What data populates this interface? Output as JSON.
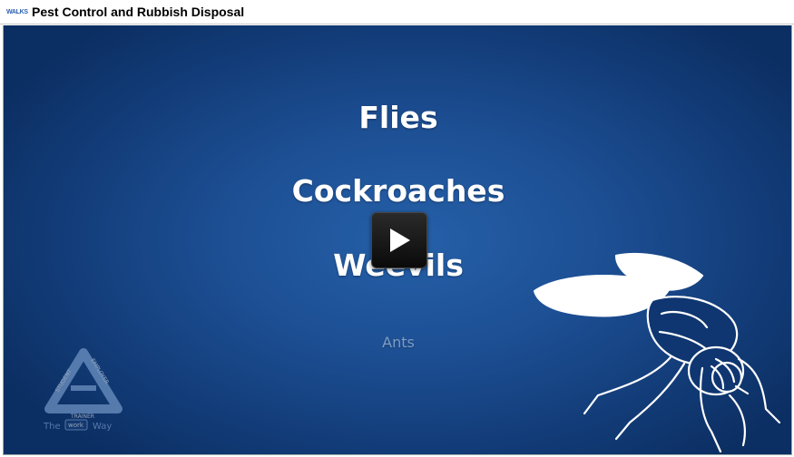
{
  "window": {
    "app_logo_text": "WALKS",
    "title": "Pest Control and Rubbish Disposal"
  },
  "slide": {
    "words": [
      "Flies",
      "Cockroaches",
      "Weevils",
      "Ants"
    ],
    "play_icon": "play-icon",
    "illustration": "fly-icon",
    "logo": {
      "student": "STUDENT",
      "employer": "EMPLOYER",
      "trainer": "TRAINER",
      "the": "The",
      "work": "work",
      "way": "Way"
    }
  },
  "colors": {
    "background_center": "#2560a8",
    "background_edge": "#0c2f63",
    "text": "#ffffff"
  }
}
